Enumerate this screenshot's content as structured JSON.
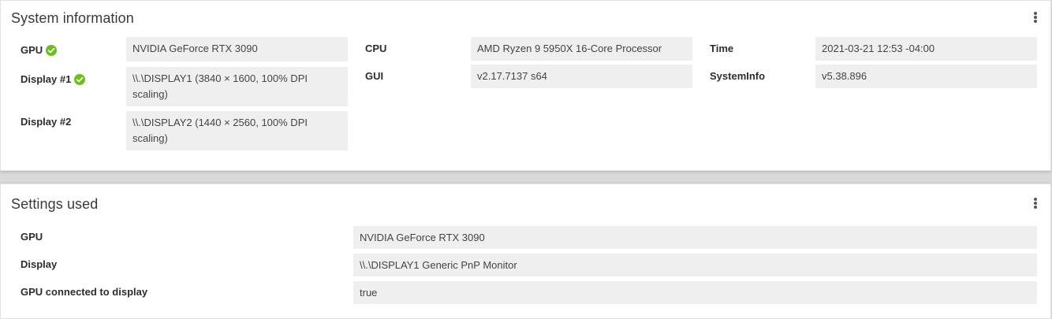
{
  "system_information": {
    "title": "System information",
    "menu_icon": "more-vertical-icon",
    "status_icon": "check-circle-icon",
    "status_color": "#6abf1e",
    "fields": {
      "gpu": {
        "label": "GPU",
        "value": "NVIDIA GeForce RTX 3090"
      },
      "display1": {
        "label": "Display #1",
        "value": "\\\\.\\DISPLAY1 (3840 × 1600, 100% DPI scaling)"
      },
      "display2": {
        "label": "Display #2",
        "value": "\\\\.\\DISPLAY2 (1440 × 2560, 100% DPI scaling)"
      },
      "cpu": {
        "label": "CPU",
        "value": "AMD Ryzen 9 5950X 16-Core Processor"
      },
      "gui": {
        "label": "GUI",
        "value": "v2.17.7137 s64"
      },
      "time": {
        "label": "Time",
        "value": "2021-03-21 12:53 -04:00"
      },
      "systeminfo": {
        "label": "SystemInfo",
        "value": "v5.38.896"
      }
    }
  },
  "settings_used": {
    "title": "Settings used",
    "menu_icon": "more-vertical-icon",
    "fields": {
      "gpu": {
        "label": "GPU",
        "value": "NVIDIA GeForce RTX 3090"
      },
      "display": {
        "label": "Display",
        "value": "\\\\.\\DISPLAY1 Generic PnP Monitor"
      },
      "gpu_connected": {
        "label": "GPU connected to display",
        "value": "true"
      }
    }
  }
}
